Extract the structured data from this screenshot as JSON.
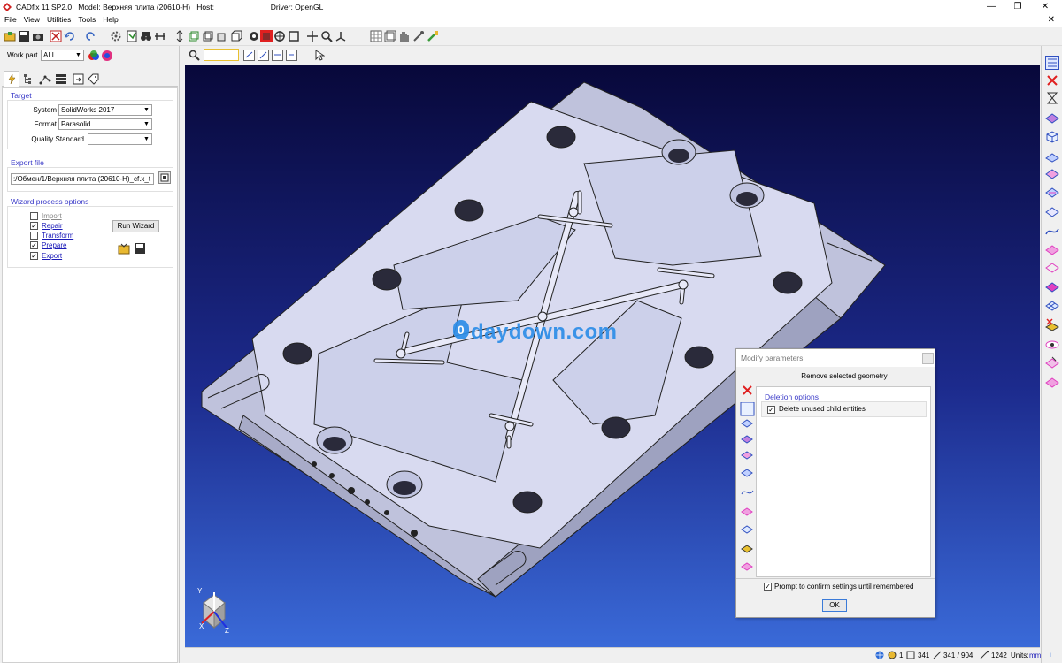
{
  "window": {
    "title": "CADfix 11 SP2.0   Model: Верхняя плита (20610-H)   Host:                           Driver: OpenGL",
    "minimize": "—",
    "maximize": "❐",
    "close": "✕"
  },
  "menu": [
    "File",
    "View",
    "Utilities",
    "Tools",
    "Help"
  ],
  "menu_close": "✕",
  "workpart": {
    "label": "Work part",
    "value": "ALL"
  },
  "target": {
    "section": "Target",
    "system_label": "System",
    "system_value": "SolidWorks 2017",
    "format_label": "Format",
    "format_value": "Parasolid",
    "quality_label": "Quality Standard",
    "quality_value": ""
  },
  "export_file": {
    "section": "Export file",
    "path": ":/Обмен/1/Верхняя плита (20610-H)_cf.x_t"
  },
  "wizard": {
    "section": "Wizard process options",
    "steps": [
      {
        "label": "Import",
        "checked": false,
        "enabled": false
      },
      {
        "label": "Repair",
        "checked": true,
        "enabled": true
      },
      {
        "label": "Transform",
        "checked": false,
        "enabled": true
      },
      {
        "label": "Prepare",
        "checked": true,
        "enabled": true
      },
      {
        "label": "Export",
        "checked": true,
        "enabled": true
      }
    ],
    "run_button": "Run Wizard"
  },
  "dialog": {
    "title": "Modify parameters",
    "action": "Remove selected geometry",
    "section": "Deletion options",
    "option1": "Delete unused child entities",
    "option1_checked": true,
    "prompt": "Prompt to confirm settings until remembered",
    "prompt_checked": true,
    "ok": "OK"
  },
  "axes": {
    "y": "Y",
    "x": "X",
    "z": "Z"
  },
  "watermark": "daydown.com",
  "status": {
    "v1": "1",
    "v2": "341",
    "v3": "341 / 904",
    "v4": "1242",
    "units_label": "Units:",
    "units_value": "mm",
    "info": "i"
  },
  "colors": {
    "viewport_top": "#08083a",
    "viewport_bottom": "#3a6ad8",
    "part": "#d8daf0",
    "section_text": "#3a3ac8",
    "pink_icon": "#e040c0"
  }
}
